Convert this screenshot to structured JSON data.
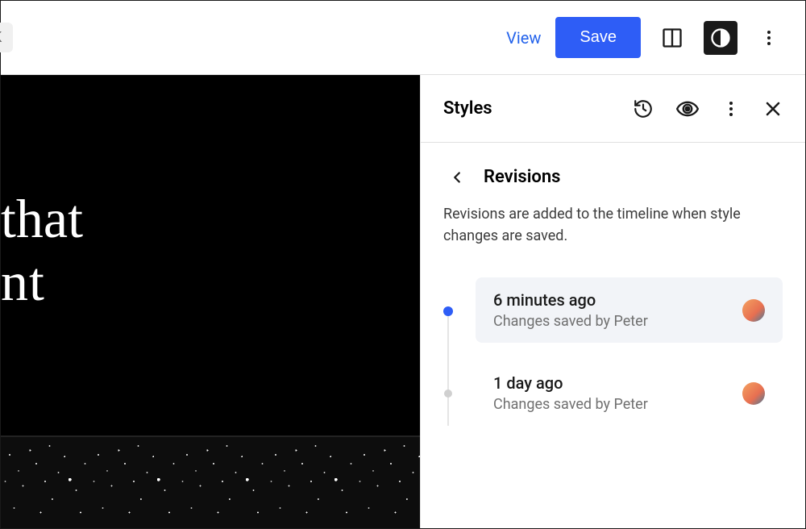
{
  "topbar": {
    "k_pill": "K",
    "view": "View",
    "save": "Save"
  },
  "canvas": {
    "line1": " that",
    "line2": "nt"
  },
  "sidebar": {
    "title": "Styles",
    "panel": {
      "title": "Revisions",
      "description": "Revisions are added to the timeline when style changes are saved."
    },
    "revisions": [
      {
        "time": "6 minutes ago",
        "by": "Changes saved by Peter",
        "active": true
      },
      {
        "time": "1 day ago",
        "by": "Changes saved by Peter",
        "active": false
      }
    ]
  }
}
